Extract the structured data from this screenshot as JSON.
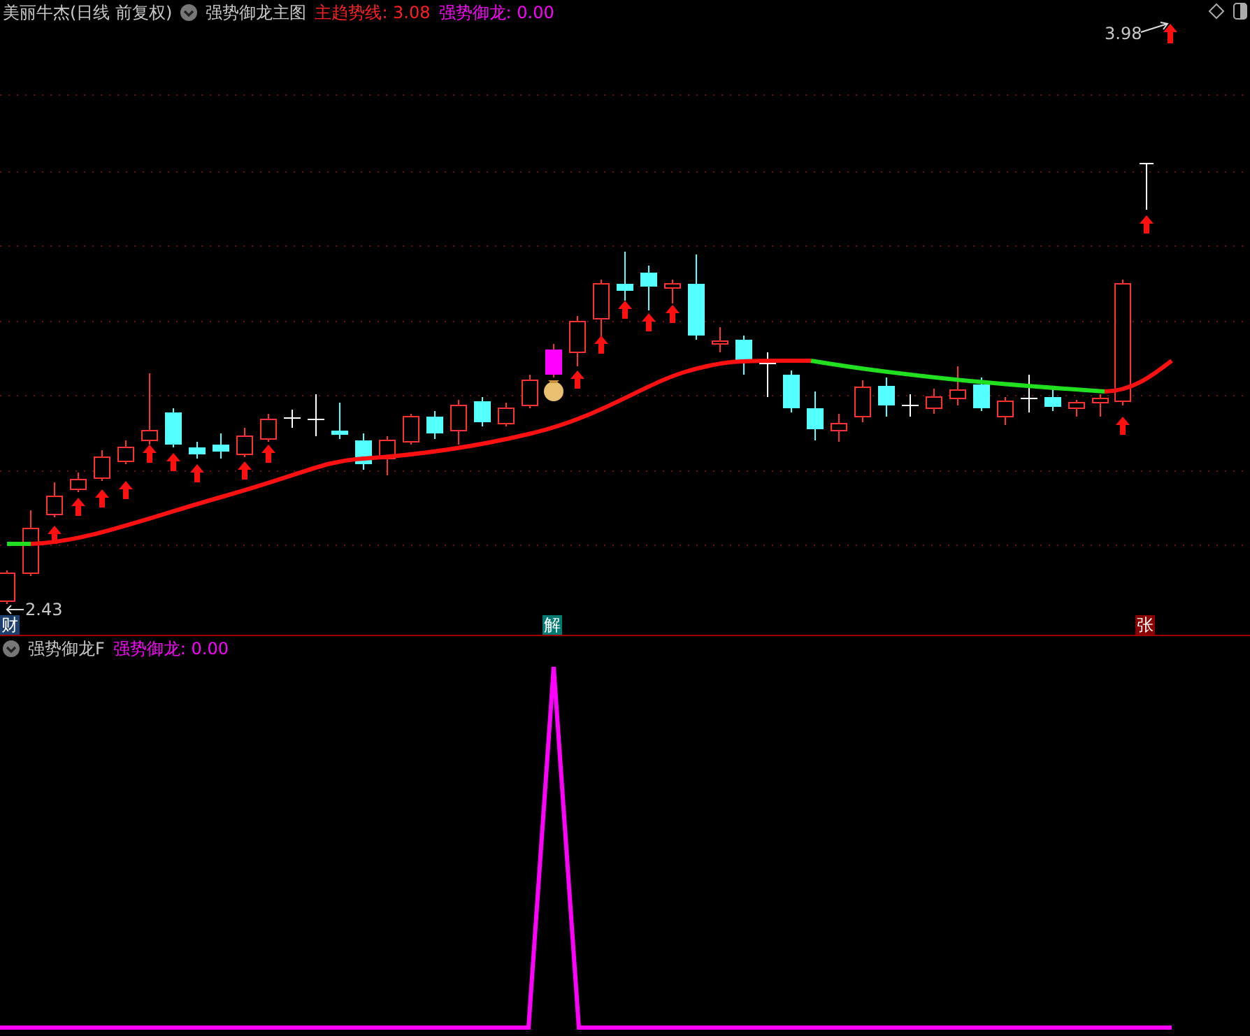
{
  "main_panel": {
    "title": "美丽牛杰(日线 前复权)",
    "indicator": "强势御龙主图",
    "readings": [
      {
        "text": "主趋势线: 3.08",
        "color": "#ff2020"
      },
      {
        "text": "强势御龙: 0.00",
        "color": "#ff00ff"
      }
    ],
    "price_labels": [
      {
        "kind": "high",
        "text": "3.98"
      },
      {
        "kind": "low",
        "text": "2.43"
      }
    ],
    "markers": [
      {
        "text": "财",
        "color": "#1c3f6e"
      },
      {
        "text": "解",
        "color": "#007a72"
      },
      {
        "text": "张",
        "color": "#8a0000"
      }
    ]
  },
  "sub_panel": {
    "indicator": "强势御龙F",
    "readings": [
      {
        "text": "强势御龙: 0.00",
        "color": "#ff00ff"
      }
    ]
  }
}
